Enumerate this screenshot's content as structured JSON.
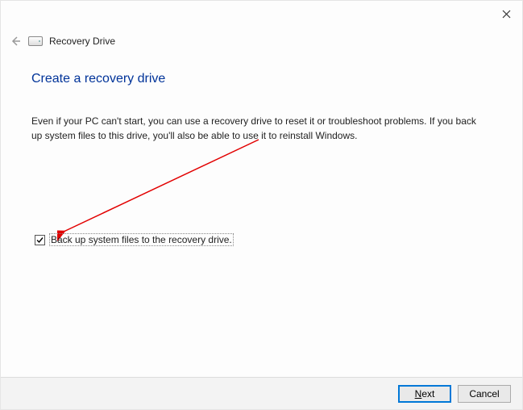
{
  "window": {
    "title": "Recovery Drive"
  },
  "page": {
    "title": "Create a recovery drive",
    "description": "Even if your PC can't start, you can use a recovery drive to reset it or troubleshoot problems. If you back up system files to this drive, you'll also be able to use it to reinstall Windows."
  },
  "checkbox": {
    "label": "Back up system files to the recovery drive.",
    "checked": true
  },
  "buttons": {
    "next_prefix": "N",
    "next_rest": "ext",
    "cancel": "Cancel"
  }
}
